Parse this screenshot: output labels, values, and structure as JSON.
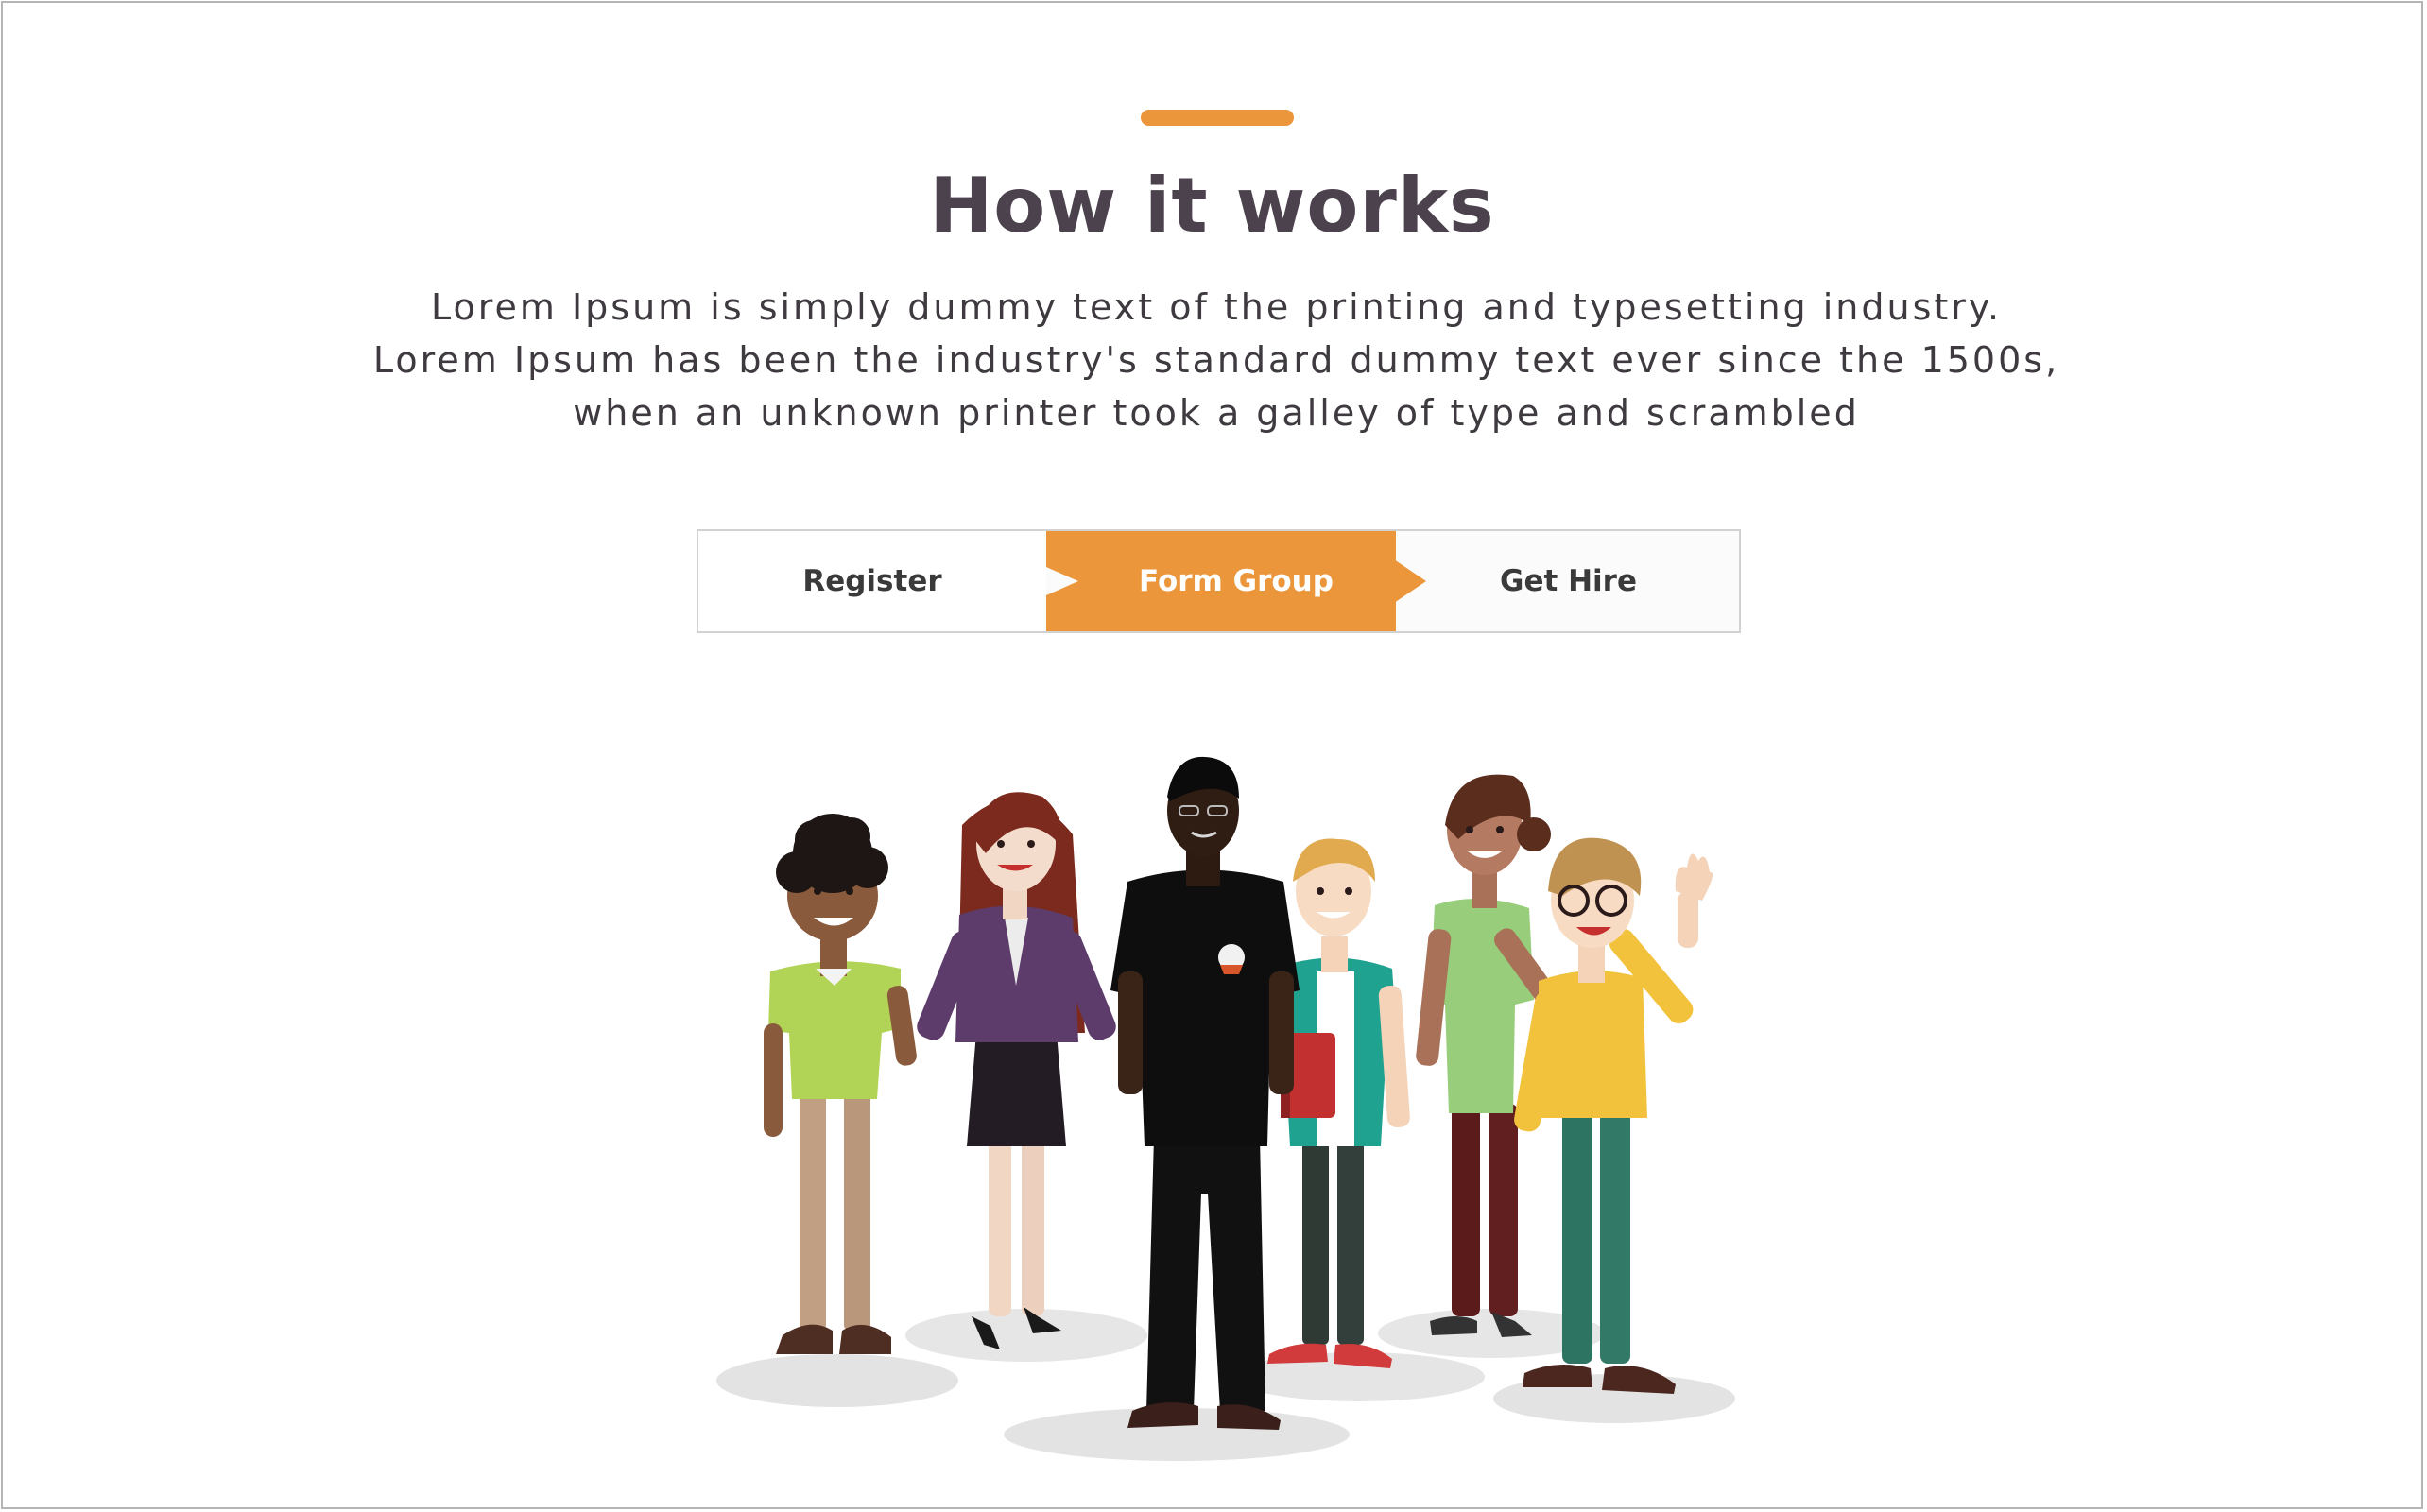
{
  "section": {
    "title": "How it works",
    "description": "Lorem Ipsum is simply dummy text of the printing and typesetting industry. Lorem Ipsum has been the industry's standard dummy text ever since the 1500s, when an unknown printer took a galley of type and scrambled"
  },
  "steps": [
    {
      "label": "Register",
      "active": false
    },
    {
      "label": "Form Group",
      "active": true
    },
    {
      "label": "Get Hire",
      "active": false
    }
  ],
  "colors": {
    "accent": "#ec963b",
    "title": "#4c424e",
    "text": "#3e3a40",
    "step_border": "#d2d2d2"
  },
  "illustration": {
    "icon": "group-of-people-illustration"
  }
}
